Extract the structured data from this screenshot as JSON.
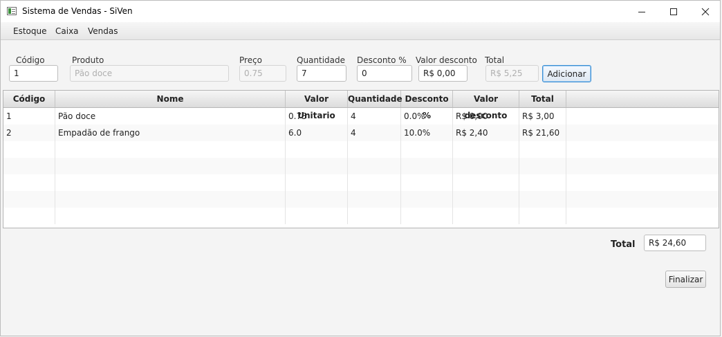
{
  "window": {
    "title": "Sistema de Vendas - SiVen"
  },
  "menu": [
    "Estoque",
    "Caixa",
    "Vendas"
  ],
  "form": {
    "codigo": {
      "label": "Código",
      "value": "1"
    },
    "produto": {
      "label": "Produto",
      "value": "Pão doce"
    },
    "preco": {
      "label": "Preço",
      "value": "0.75"
    },
    "quantidade": {
      "label": "Quantidade",
      "value": "7"
    },
    "desconto": {
      "label": "Desconto %",
      "value": "0"
    },
    "valor_desconto": {
      "label": "Valor desconto",
      "value": "R$ 0,00"
    },
    "total": {
      "label": "Total",
      "value": "R$ 5,25"
    },
    "adicionar_label": "Adicionar"
  },
  "table": {
    "columns": [
      "Código",
      "Nome",
      "Valor Unitario",
      "Quantidade",
      "Desconto %",
      "Valor desconto",
      "Total"
    ],
    "rows": [
      [
        "1",
        "Pão doce",
        "0.75",
        "4",
        "0.0%",
        "R$ 0,00",
        "R$ 3,00"
      ],
      [
        "2",
        "Empadão de frango",
        "6.0",
        "4",
        "10.0%",
        "R$ 2,40",
        "R$ 21,60"
      ]
    ]
  },
  "summary": {
    "total_label": "Total",
    "total_value": "R$ 24,60",
    "finalizar_label": "Finalizar"
  }
}
